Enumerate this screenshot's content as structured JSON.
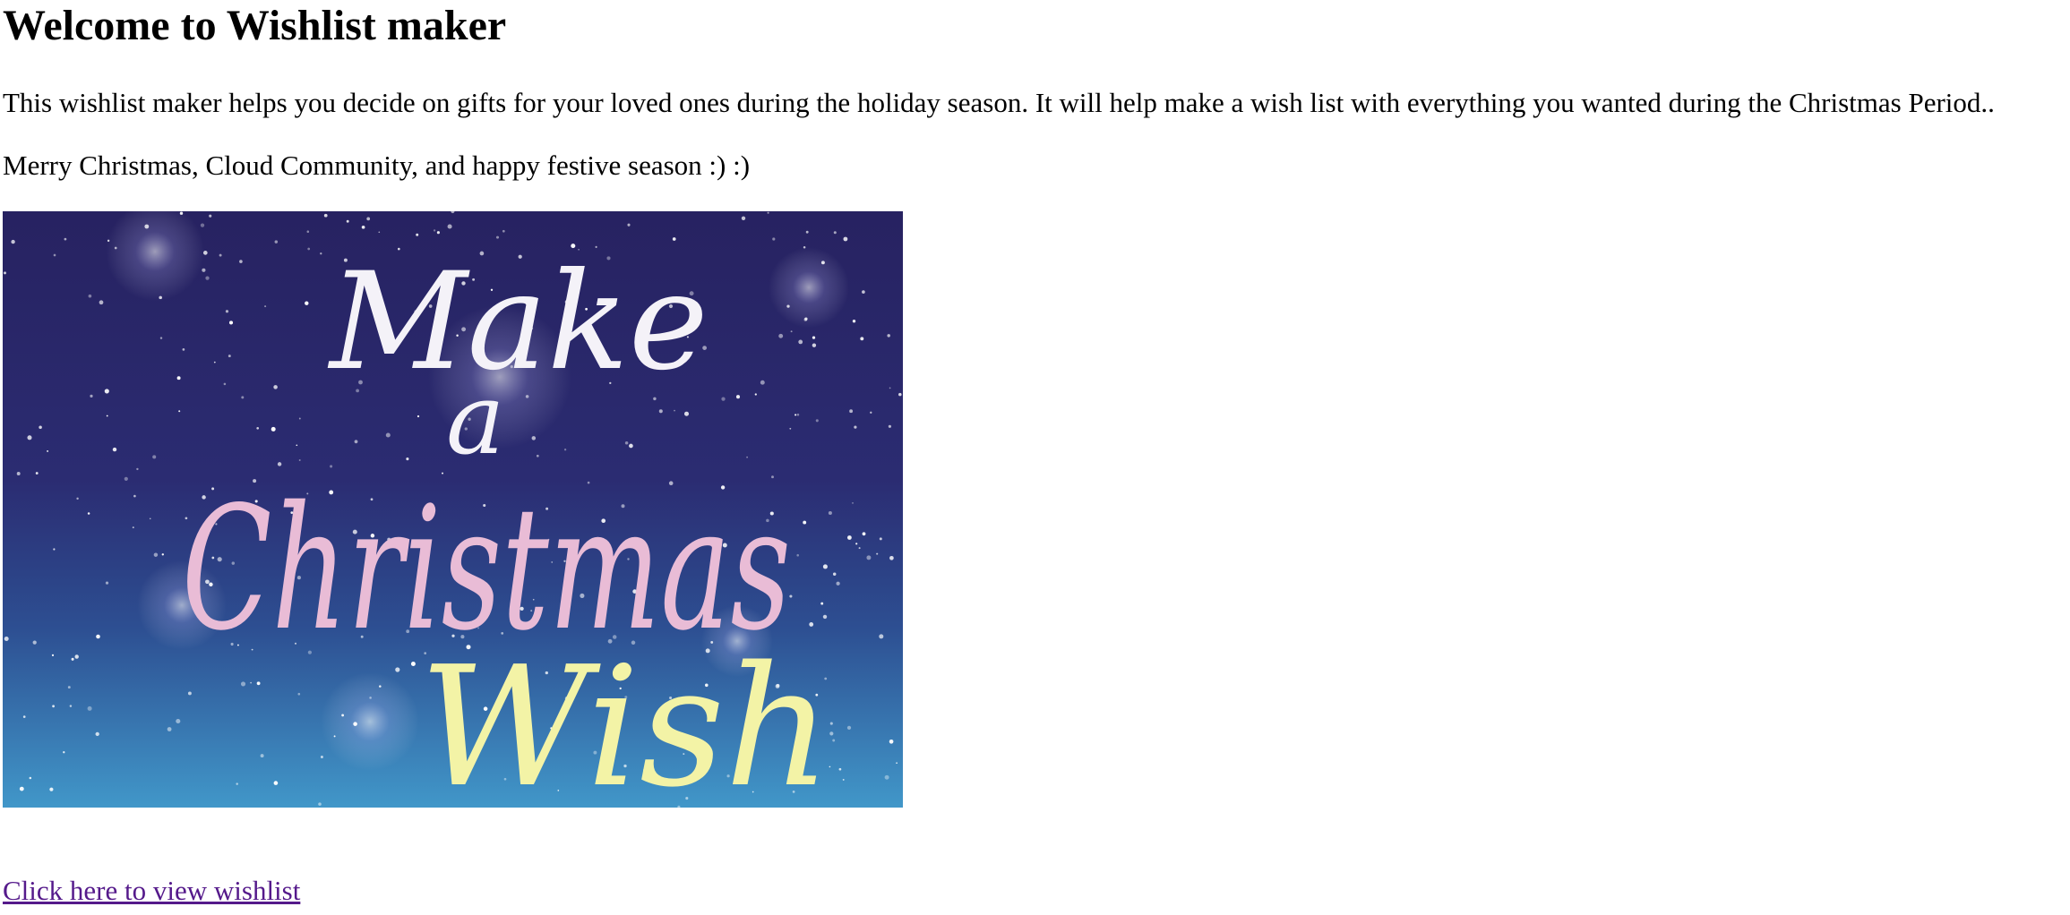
{
  "page": {
    "heading": "Welcome to Wishlist maker",
    "intro": "This wishlist maker helps you decide on gifts for your loved ones during the holiday season. It will help make a wish list with everything you wanted during the Christmas Period..",
    "greeting": "Merry Christmas, Cloud Community, and happy festive season :) :)",
    "link_label": "Click here to view wishlist"
  },
  "banner": {
    "word_1": "Make",
    "word_2": "a",
    "word_3": "Christmas",
    "word_4": "Wish",
    "colors": {
      "sky_top": "#2a2466",
      "sky_mid": "#2c3f86",
      "sky_bottom": "#3f8fc4",
      "white_text": "#f4f2f8",
      "pink_text": "#e9bcd6",
      "yellow_text": "#f3f3a6"
    }
  },
  "colors": {
    "link_visited": "#551a8b",
    "text": "#000000",
    "background": "#ffffff"
  }
}
